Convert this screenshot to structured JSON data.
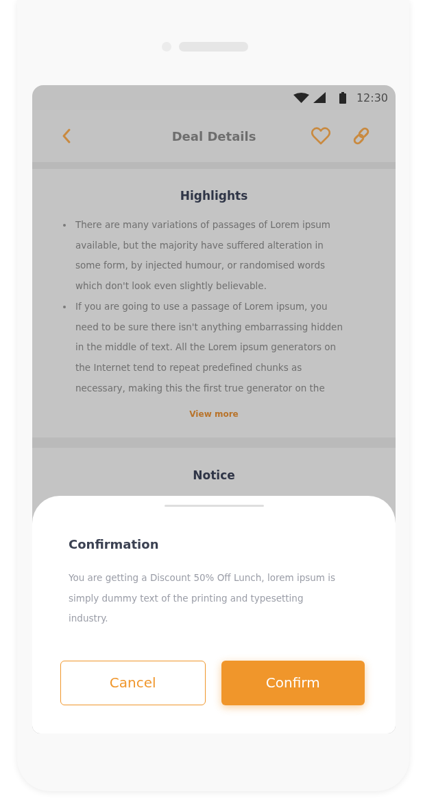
{
  "status_bar": {
    "time": "12:30"
  },
  "app_bar": {
    "title": "Deal Details"
  },
  "highlights": {
    "title": "Highlights",
    "items": [
      "There are many variations of passages of Lorem ipsum available, but the majority have suffered alteration in some form, by injected humour, or randomised words which don't look even slightly believable.",
      "If you are going to use a passage of Lorem ipsum, you need to be sure there isn't anything embarrassing hidden in the middle of text. All the Lorem ipsum generators on the Internet tend to repeat predefined chunks as necessary, making this the first true generator on the"
    ],
    "view_more": "View more"
  },
  "notice": {
    "title": "Notice"
  },
  "sheet": {
    "title": "Confirmation",
    "message": "You are getting a Discount 50% Off Lunch, lorem ipsum is simply dummy text of the printing and typesetting industry.",
    "buttons": [
      {
        "label": "Cancel",
        "kind": "outline"
      },
      {
        "label": "Confirm",
        "kind": "filled"
      }
    ]
  }
}
